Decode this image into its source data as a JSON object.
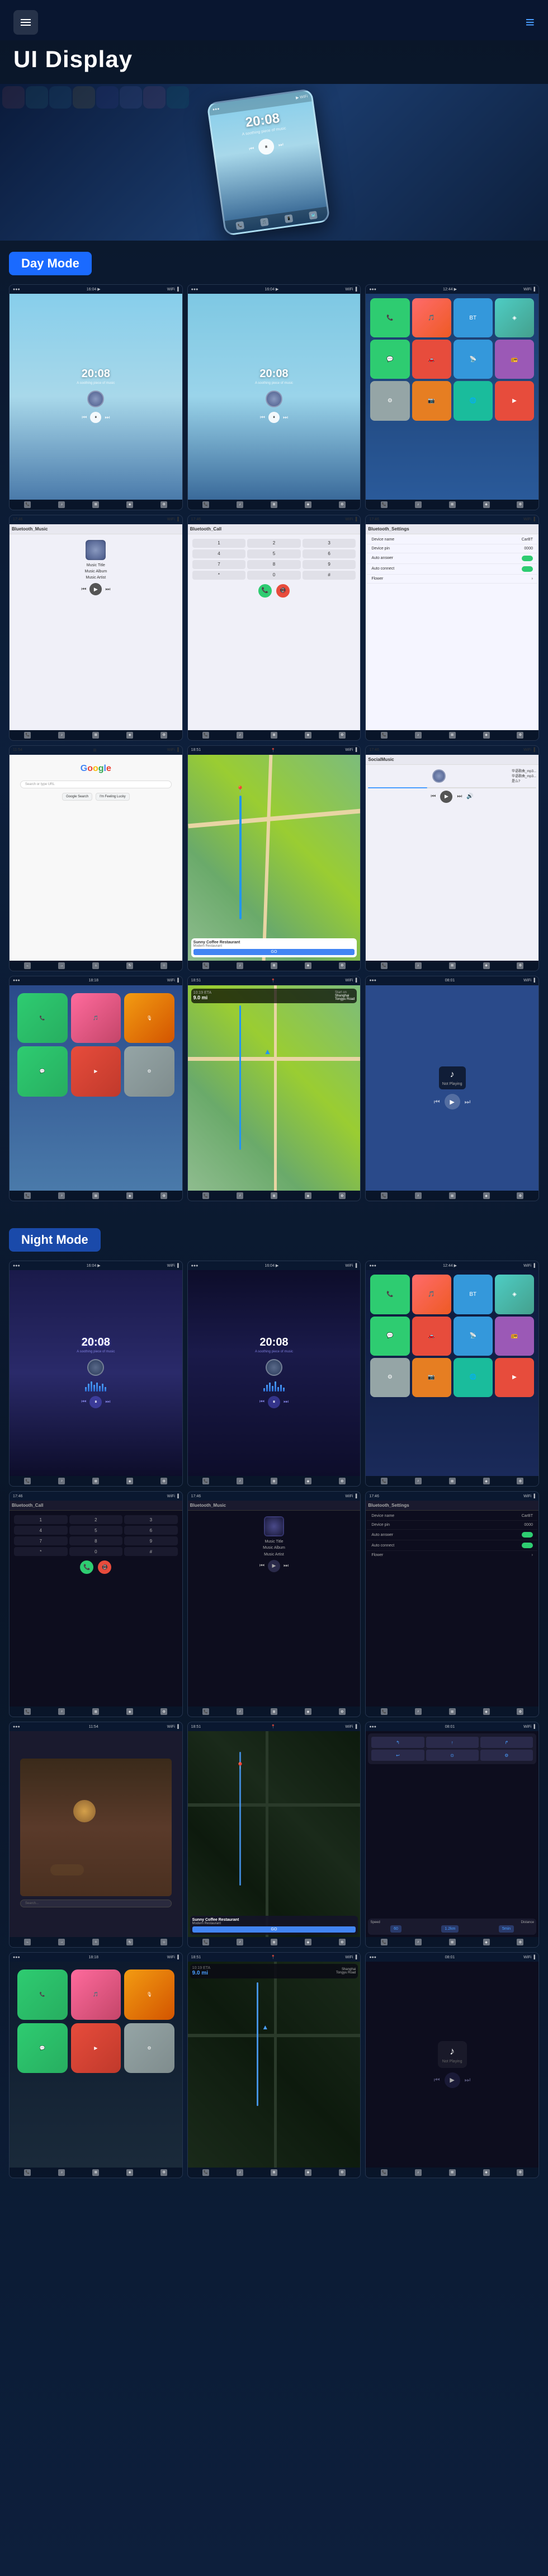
{
  "header": {
    "title": "UI Display",
    "menu_icon": "☰",
    "lines_icon": "≡"
  },
  "day_mode": {
    "label": "Day Mode",
    "screenshots": [
      {
        "id": "day-music-1",
        "time": "20:08",
        "sub": "A soothing piece of music",
        "type": "music"
      },
      {
        "id": "day-music-2",
        "time": "20:08",
        "sub": "A soothing piece of music",
        "type": "music"
      },
      {
        "id": "day-apps",
        "type": "apps"
      },
      {
        "id": "day-bt-music",
        "title": "Bluetooth_Music",
        "type": "bluetooth_music"
      },
      {
        "id": "day-bt-call",
        "title": "Bluetooth_Call",
        "type": "bluetooth_call"
      },
      {
        "id": "day-bt-settings",
        "title": "Bluetooth_Settings",
        "type": "bluetooth_settings"
      },
      {
        "id": "day-google",
        "type": "google"
      },
      {
        "id": "day-maps",
        "type": "maps"
      },
      {
        "id": "day-local-music",
        "type": "local_music"
      }
    ]
  },
  "carplay_section": {
    "screenshots": [
      {
        "id": "cp-home",
        "type": "carplay_home"
      },
      {
        "id": "cp-map",
        "type": "carplay_map"
      },
      {
        "id": "cp-nav",
        "type": "carplay_nav"
      }
    ]
  },
  "night_mode": {
    "label": "Night Mode",
    "screenshots": [
      {
        "id": "night-music-1",
        "time": "20:08",
        "type": "music_night"
      },
      {
        "id": "night-music-2",
        "time": "20:08",
        "type": "music_night2"
      },
      {
        "id": "night-apps",
        "type": "apps_night"
      },
      {
        "id": "night-bt-call",
        "title": "Bluetooth_Call",
        "type": "bluetooth_call_night"
      },
      {
        "id": "night-bt-music",
        "title": "Bluetooth_Music",
        "type": "bluetooth_music_night"
      },
      {
        "id": "night-bt-settings",
        "title": "Bluetooth_Settings",
        "type": "bluetooth_settings_night"
      },
      {
        "id": "night-google",
        "type": "google_night"
      },
      {
        "id": "night-maps",
        "type": "maps_night"
      },
      {
        "id": "night-local-music",
        "type": "local_music_night"
      }
    ]
  },
  "night_carplay": {
    "screenshots": [
      {
        "id": "ncp-home",
        "type": "carplay_home_night"
      },
      {
        "id": "ncp-map",
        "type": "carplay_map_night"
      },
      {
        "id": "ncp-nav",
        "type": "carplay_nav_night"
      }
    ]
  },
  "music_info": {
    "title": "Music Title",
    "album": "Music Album",
    "artist": "Music Artist"
  },
  "bluetooth": {
    "device_name_label": "Device name",
    "device_name_value": "CarBT",
    "device_pin_label": "Device pin",
    "device_pin_value": "0000",
    "auto_answer_label": "Auto answer",
    "auto_connect_label": "Auto connect",
    "flower_label": "Flower"
  },
  "google": {
    "search_placeholder": "Search or type URL"
  },
  "carplay": {
    "coffee_shop": "Sunny Coffee Restaurant",
    "eta_label": "10:19 ETA",
    "distance": "9.0 mi",
    "go_label": "GO",
    "not_playing": "Not Playing",
    "start_label": "Start on Shanghai Tongyu Road"
  },
  "nav_bar": {
    "items": [
      "📞",
      "🎵",
      "📱",
      "🗺️",
      "⚙️"
    ]
  }
}
